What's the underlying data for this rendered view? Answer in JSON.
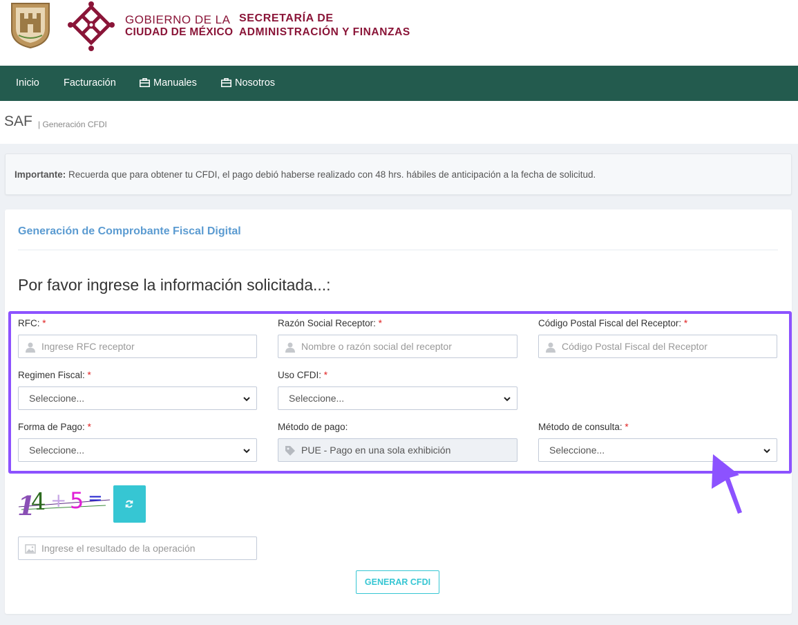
{
  "header": {
    "gov_line1": "GOBIERNO DE LA",
    "gov_line2": "CIUDAD DE MÉXICO",
    "sec_line1": "SECRETARÍA DE",
    "sec_line2": "ADMINISTRACIÓN Y FINANZAS",
    "brand_color": "#8a1538"
  },
  "nav": {
    "bg_color": "#235b4e",
    "items": [
      {
        "label": "Inicio",
        "icon": ""
      },
      {
        "label": "Facturación",
        "icon": ""
      },
      {
        "label": "Manuales",
        "icon": "briefcase-icon"
      },
      {
        "label": "Nosotros",
        "icon": "briefcase-icon"
      }
    ]
  },
  "breadcrumb": {
    "title": "SAF",
    "subtitle": "| Generación CFDI"
  },
  "alert": {
    "bold": "Importante:",
    "text": " Recuerda que para obtener tu CFDI, el pago debió haberse realizado con 48 hrs. hábiles de anticipación a la fecha de solicitud."
  },
  "panel": {
    "title": "Generación de Comprobante Fiscal Digital",
    "heading": "Por favor ingrese la información solicitada...:"
  },
  "form": {
    "required_mark": "*",
    "rfc": {
      "label": "RFC:",
      "placeholder": "Ingrese RFC receptor",
      "icon": "user-icon"
    },
    "razon_social": {
      "label": "Razón Social Receptor:",
      "placeholder": "Nombre o razón social del receptor",
      "icon": "user-icon"
    },
    "codigo_postal": {
      "label": "Código Postal Fiscal del Receptor:",
      "placeholder": "Código Postal Fiscal del Receptor",
      "icon": "user-icon"
    },
    "regimen_fiscal": {
      "label": "Regimen Fiscal:",
      "value": "Seleccione..."
    },
    "uso_cfdi": {
      "label": "Uso CFDI:",
      "value": "Seleccione..."
    },
    "forma_pago": {
      "label": "Forma de Pago:",
      "value": "Seleccione..."
    },
    "metodo_pago": {
      "label": "Método de pago:",
      "value": "PUE - Pago en una sola exhibición",
      "icon": "tag-icon"
    },
    "metodo_consulta": {
      "label": "Método de consulta:",
      "value": "Seleccione..."
    }
  },
  "captcha": {
    "chars": [
      "1",
      "4",
      "+",
      "5",
      "="
    ],
    "result_placeholder": "Ingrese el resultado de la operación",
    "icon": "image-icon",
    "refresh_icon": "refresh-icon"
  },
  "submit": {
    "label": "GENERAR CFDI"
  },
  "colors": {
    "highlight": "#8c52ff",
    "accent": "#36c6d3",
    "title_blue": "#5b9bd1",
    "required": "#e02222"
  }
}
